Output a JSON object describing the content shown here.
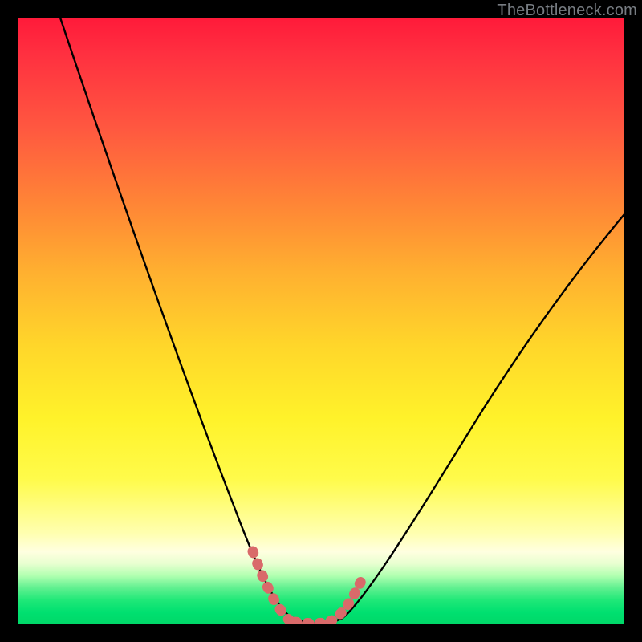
{
  "watermark": {
    "text": "TheBottleneck.com"
  },
  "colors": {
    "frame": "#000000",
    "curve": "#000000",
    "marker": "#d96a6a",
    "gradient_top": "#ff1a3a",
    "gradient_mid": "#fff22a",
    "gradient_bottom": "#00d868"
  },
  "chart_data": {
    "type": "line",
    "title": "",
    "xlabel": "",
    "ylabel": "",
    "xlim": [
      0,
      100
    ],
    "ylim": [
      0,
      100
    ],
    "grid": false,
    "legend": false,
    "series": [
      {
        "name": "left-curve",
        "x": [
          7,
          10,
          14,
          18,
          22,
          26,
          30,
          33,
          36,
          38,
          40,
          41.5,
          43,
          44.5
        ],
        "y": [
          100,
          90,
          78,
          66,
          54,
          42,
          31,
          22,
          15,
          10,
          6,
          3.5,
          1.8,
          0.6
        ]
      },
      {
        "name": "right-curve",
        "x": [
          52,
          54,
          57,
          61,
          66,
          72,
          79,
          86,
          93,
          100
        ],
        "y": [
          0.8,
          2.5,
          6,
          12,
          20,
          30,
          41,
          51,
          60,
          68
        ]
      },
      {
        "name": "trough",
        "x": [
          44.5,
          46,
          48,
          50,
          52
        ],
        "y": [
          0.6,
          0.2,
          0.1,
          0.2,
          0.8
        ]
      }
    ],
    "markers": [
      {
        "name": "left-marker-run",
        "x_range": [
          38.5,
          44.5
        ],
        "y_approx": [
          9,
          0.6
        ]
      },
      {
        "name": "right-marker-run",
        "x_range": [
          50.5,
          54.5
        ],
        "y_approx": [
          0.4,
          3.2
        ]
      }
    ],
    "annotations": []
  }
}
